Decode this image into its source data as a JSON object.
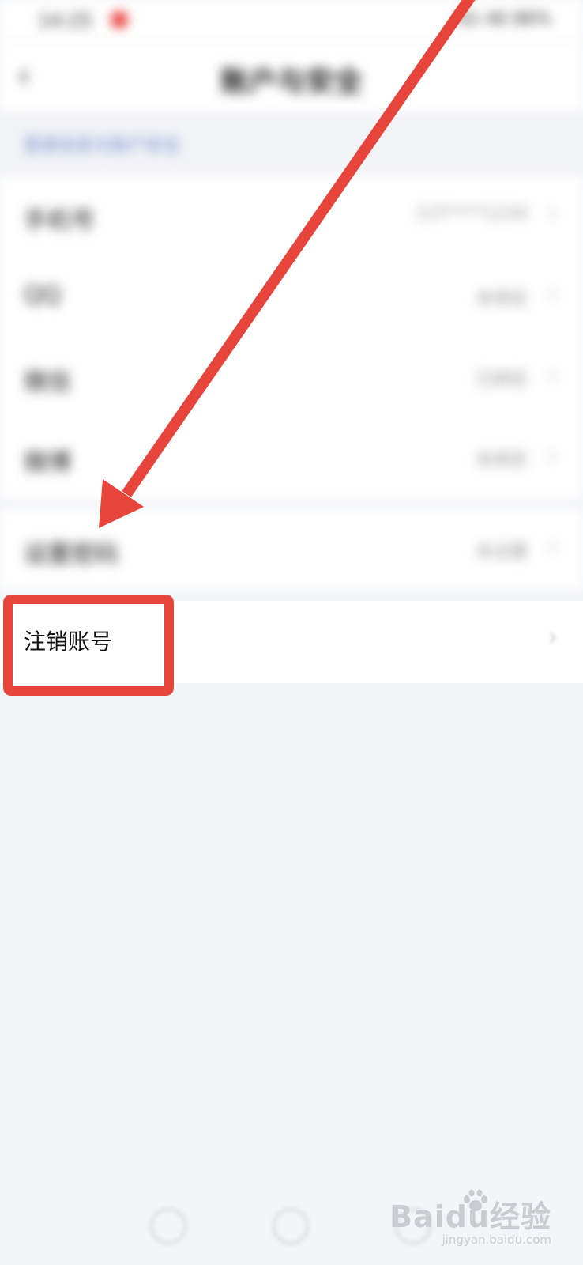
{
  "status_bar": {
    "time": "14:25",
    "right_text": "5G 46 86%"
  },
  "nav": {
    "back_glyph": "‹",
    "title": "账户与安全"
  },
  "section": {
    "header": "登录信息与账户安全"
  },
  "group1": {
    "rows": [
      {
        "label": "手机号",
        "value": "137****1234",
        "chevron": "›"
      },
      {
        "label": "QQ",
        "value": "未绑定",
        "chevron": "›"
      },
      {
        "label": "微信",
        "value": "已绑定",
        "chevron": "›"
      },
      {
        "label": "微博",
        "value": "未绑定",
        "chevron": "›"
      }
    ]
  },
  "group2": {
    "rows": [
      {
        "label": "设置密码",
        "value": "未设置",
        "chevron": "›"
      }
    ]
  },
  "cancel_account": {
    "label": "注销账号",
    "chevron": "›"
  },
  "watermark": {
    "brand": "Baidu经验",
    "url": "jingyan.baidu.com"
  },
  "colors": {
    "annotation_red": "#e7453b",
    "background": "#f4f5f8"
  },
  "icons": [
    "back-icon",
    "chevron-right-icon",
    "red-arrow",
    "paw-icon"
  ]
}
